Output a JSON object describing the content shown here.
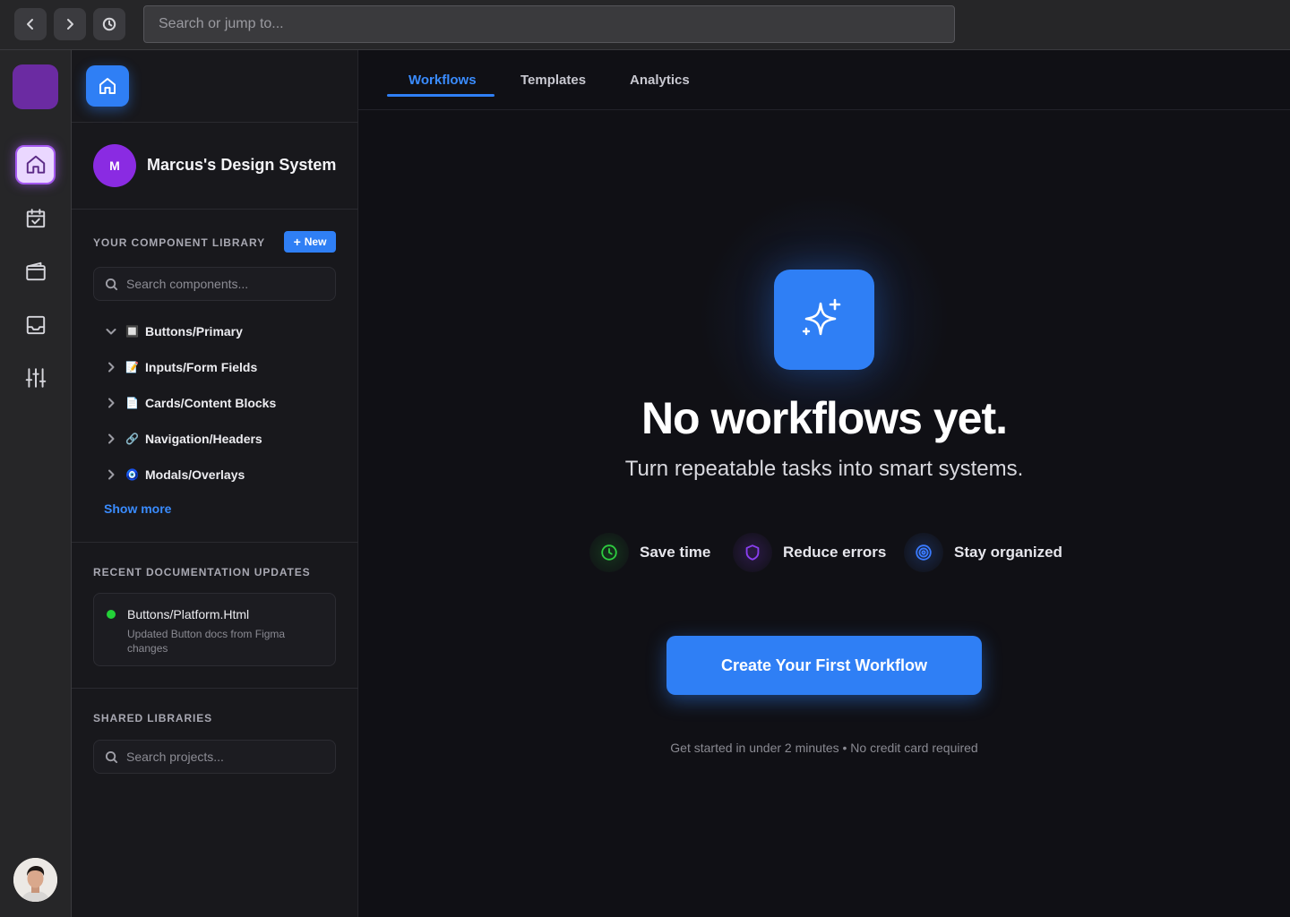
{
  "topbar": {
    "search_placeholder": "Search or jump to..."
  },
  "rail": {
    "items": [
      "home",
      "calendar",
      "wallet",
      "inbox",
      "settings"
    ]
  },
  "workspace": {
    "initial": "M",
    "name": "Marcus's Design System"
  },
  "library": {
    "title": "YOUR COMPONENT LIBRARY",
    "new_label": "New",
    "search_placeholder": "Search components...",
    "items": [
      {
        "label": "Buttons/Primary",
        "emoji": "🔲",
        "expanded": true
      },
      {
        "label": "Inputs/Form Fields",
        "emoji": "📝",
        "expanded": false
      },
      {
        "label": "Cards/Content Blocks",
        "emoji": "📄",
        "expanded": false
      },
      {
        "label": "Navigation/Headers",
        "emoji": "🔗",
        "expanded": false
      },
      {
        "label": "Modals/Overlays",
        "emoji": "🧿",
        "expanded": false
      }
    ],
    "show_more": "Show more"
  },
  "docs": {
    "title": "RECENT DOCUMENTATION UPDATES",
    "item": {
      "title": "Buttons/Platform.Html",
      "description": "Updated Button docs from Figma changes",
      "status_color": "#23d138"
    }
  },
  "shared": {
    "title": "SHARED LIBRARIES",
    "search_placeholder": "Search projects..."
  },
  "tabs": [
    {
      "label": "Workflows",
      "active": true
    },
    {
      "label": "Templates",
      "active": false
    },
    {
      "label": "Analytics",
      "active": false
    }
  ],
  "empty_state": {
    "title": "No workflows yet.",
    "subtitle": "Turn repeatable tasks into smart systems.",
    "features": [
      {
        "label": "Save time",
        "icon": "clock-icon",
        "color": "#2ecc40"
      },
      {
        "label": "Reduce errors",
        "icon": "shield-icon",
        "color": "#8a3ff0"
      },
      {
        "label": "Stay organized",
        "icon": "target-icon",
        "color": "#3a7bff"
      }
    ],
    "cta_label": "Create Your First Workflow",
    "note": "Get started in under 2 minutes • No credit card required"
  },
  "colors": {
    "accent": "#2f7ff5",
    "brand_purple": "#6b2ba2",
    "background": "#101015"
  }
}
